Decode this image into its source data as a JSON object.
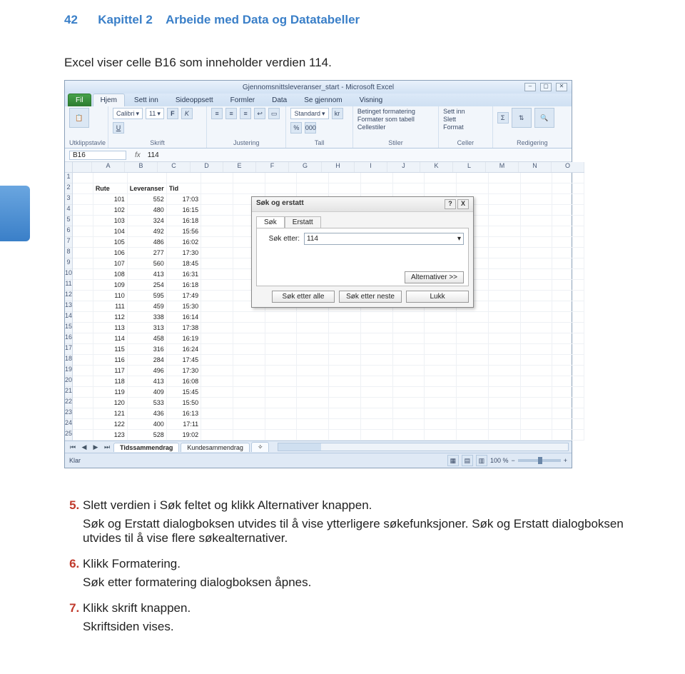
{
  "header": {
    "page_num": "42",
    "chapter": "Kapittel 2",
    "title": "Arbeide med Data og Datatabeller"
  },
  "intro": "Excel viser celle B16 som inneholder verdien 114.",
  "excel": {
    "window_title": "Gjennomsnittsleveranser_start - Microsoft Excel",
    "tabs": {
      "file": "Fil",
      "home": "Hjem",
      "insert": "Sett inn",
      "layout": "Sideoppsett",
      "formulas": "Formler",
      "data": "Data",
      "review": "Se gjennom",
      "view": "Visning"
    },
    "groups": {
      "clipboard": "Utklippstavle",
      "font": "Skrift",
      "alignment": "Justering",
      "number": "Tall",
      "styles": "Stiler",
      "cells": "Celler",
      "editing": "Redigering",
      "paste": "Lim inn"
    },
    "font_name": "Calibri",
    "font_size": "11",
    "number_format": "Standard",
    "styles_buttons": {
      "cond": "Betinget formatering",
      "table": "Formater som tabell",
      "cellstyles": "Cellestiler"
    },
    "cells_buttons": {
      "insert": "Sett inn",
      "delete": "Slett",
      "format": "Format"
    },
    "editing_buttons": {
      "sort": "Sorter og filtrer",
      "find": "Søk etter og merk"
    },
    "name_box": "B16",
    "formula_value": "114",
    "columns": [
      "A",
      "B",
      "C",
      "D",
      "E",
      "F",
      "G",
      "H",
      "I",
      "J",
      "K",
      "L",
      "M",
      "N",
      "O"
    ],
    "headers": {
      "b": "Rute",
      "c": "Leveranser",
      "d": "Tid"
    },
    "rows": [
      {
        "n": "1"
      },
      {
        "n": "2",
        "b": "Rute",
        "c": "Leveranser",
        "d": "Tid",
        "head": true
      },
      {
        "n": "3",
        "b": "101",
        "c": "552",
        "d": "17:03"
      },
      {
        "n": "4",
        "b": "102",
        "c": "480",
        "d": "16:15"
      },
      {
        "n": "5",
        "b": "103",
        "c": "324",
        "d": "16:18"
      },
      {
        "n": "6",
        "b": "104",
        "c": "492",
        "d": "15:56"
      },
      {
        "n": "7",
        "b": "105",
        "c": "486",
        "d": "16:02"
      },
      {
        "n": "8",
        "b": "106",
        "c": "277",
        "d": "17:30"
      },
      {
        "n": "9",
        "b": "107",
        "c": "560",
        "d": "18:45"
      },
      {
        "n": "10",
        "b": "108",
        "c": "413",
        "d": "16:31"
      },
      {
        "n": "11",
        "b": "109",
        "c": "254",
        "d": "16:18"
      },
      {
        "n": "12",
        "b": "110",
        "c": "595",
        "d": "17:49"
      },
      {
        "n": "13",
        "b": "111",
        "c": "459",
        "d": "15:30"
      },
      {
        "n": "14",
        "b": "112",
        "c": "338",
        "d": "16:14"
      },
      {
        "n": "15",
        "b": "113",
        "c": "313",
        "d": "17:38"
      },
      {
        "n": "16",
        "b": "114",
        "c": "458",
        "d": "16:19"
      },
      {
        "n": "17",
        "b": "115",
        "c": "316",
        "d": "16:24"
      },
      {
        "n": "18",
        "b": "116",
        "c": "284",
        "d": "17:45"
      },
      {
        "n": "19",
        "b": "117",
        "c": "496",
        "d": "17:30"
      },
      {
        "n": "20",
        "b": "118",
        "c": "413",
        "d": "16:08"
      },
      {
        "n": "21",
        "b": "119",
        "c": "409",
        "d": "15:45"
      },
      {
        "n": "22",
        "b": "120",
        "c": "533",
        "d": "15:50"
      },
      {
        "n": "23",
        "b": "121",
        "c": "436",
        "d": "16:13"
      },
      {
        "n": "24",
        "b": "122",
        "c": "400",
        "d": "17:11"
      },
      {
        "n": "25",
        "b": "123",
        "c": "528",
        "d": "19:02"
      }
    ],
    "sheets": {
      "s1": "Tidssammendrag",
      "s2": "Kundesammendrag"
    },
    "status": "Klar",
    "zoom": "100 %"
  },
  "dialog": {
    "title": "Søk og erstatt",
    "tab_find": "Søk",
    "tab_replace": "Erstatt",
    "find_label": "Søk etter:",
    "find_value": "114",
    "options": "Alternativer >>",
    "find_all": "Søk etter alle",
    "find_next": "Søk etter neste",
    "close": "Lukk",
    "help": "?",
    "x": "X"
  },
  "steps": {
    "s5_a": "Slett verdien i Søk feltet og klikk Alternativer knappen.",
    "s5_b": "Søk og Erstatt dialogboksen utvides til å vise ytterligere søkefunksjoner. Søk og Erstatt dialogboksen utvides til å vise flere søkealternativer.",
    "s6_a": "Klikk Formatering.",
    "s6_b": "Søk etter formatering dialogboksen åpnes.",
    "s7_a": "Klikk skrift knappen.",
    "s7_b": "Skriftsiden vises."
  }
}
